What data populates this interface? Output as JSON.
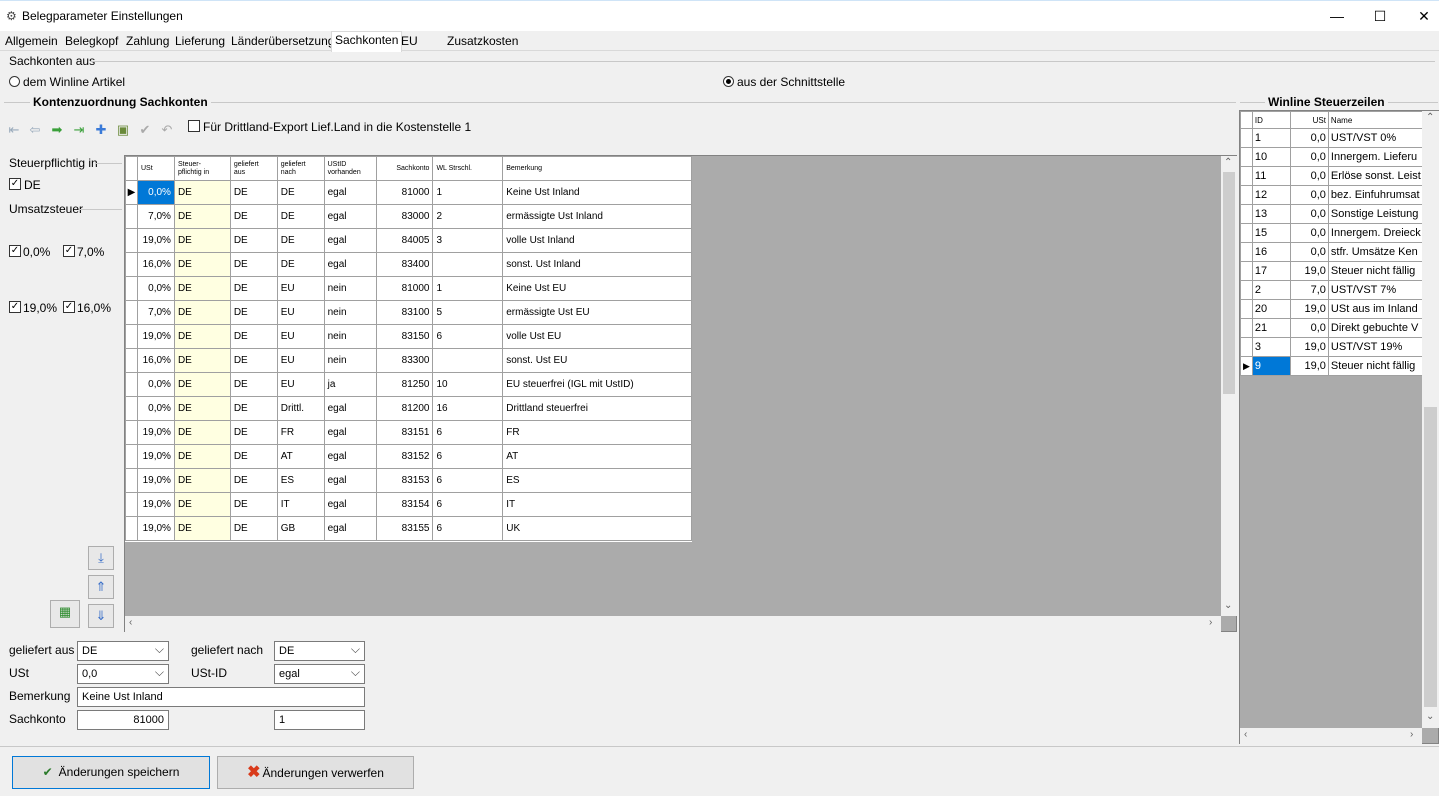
{
  "window": {
    "title": "Belegparameter Einstellungen",
    "minimize": "—",
    "maximize": "☐",
    "close": "✕"
  },
  "tabs": [
    "Allgemein",
    "Belegkopf",
    "Zahlung",
    "Lieferung",
    "Länderübersetzung",
    "Sachkonten",
    "EU",
    "Zusatzkosten"
  ],
  "active_tab": "Sachkonten",
  "source": {
    "label": "Sachkonten aus",
    "option1": "dem Winline Artikel",
    "option2": "aus der Schnittstelle",
    "selected": "aus der Schnittstelle"
  },
  "assignment": {
    "title": "Kontenzuordnung Sachkonten",
    "checkbox_label": "Für Drittland-Export Lief.Land in die Kostenstelle 1"
  },
  "filters": {
    "steuer_label": "Steuerpflichtig in",
    "de": "DE",
    "ust_label": "Umsatzsteuer",
    "r0": "0,0%",
    "r7": "7,0%",
    "r19": "19,0%",
    "r16": "16,0%"
  },
  "grid": {
    "headers": [
      "USt",
      "Steuer-\npflichtig in",
      "geliefert\naus",
      "geliefert\nnach",
      "UStID\nvorhanden",
      "Sachkonto",
      "WL Strschl.",
      "Bemerkung"
    ],
    "rows": [
      [
        "0,0%",
        "DE",
        "DE",
        "DE",
        "egal",
        "81000",
        "1",
        "Keine Ust Inland"
      ],
      [
        "7,0%",
        "DE",
        "DE",
        "DE",
        "egal",
        "83000",
        "2",
        "ermässigte Ust Inland"
      ],
      [
        "19,0%",
        "DE",
        "DE",
        "DE",
        "egal",
        "84005",
        "3",
        "volle Ust Inland"
      ],
      [
        "16,0%",
        "DE",
        "DE",
        "DE",
        "egal",
        "83400",
        "",
        "sonst. Ust Inland"
      ],
      [
        "0,0%",
        "DE",
        "DE",
        "EU",
        "nein",
        "81000",
        "1",
        "Keine Ust EU"
      ],
      [
        "7,0%",
        "DE",
        "DE",
        "EU",
        "nein",
        "83100",
        "5",
        "ermässigte Ust EU"
      ],
      [
        "19,0%",
        "DE",
        "DE",
        "EU",
        "nein",
        "83150",
        "6",
        "volle Ust EU"
      ],
      [
        "16,0%",
        "DE",
        "DE",
        "EU",
        "nein",
        "83300",
        "",
        "sonst. Ust EU"
      ],
      [
        "0,0%",
        "DE",
        "DE",
        "EU",
        "ja",
        "81250",
        "10",
        "EU steuerfrei (IGL mit UstID)"
      ],
      [
        "0,0%",
        "DE",
        "DE",
        "Drittl.",
        "egal",
        "81200",
        "16",
        "Drittland steuerfrei"
      ],
      [
        "19,0%",
        "DE",
        "DE",
        "FR",
        "egal",
        "83151",
        "6",
        "FR"
      ],
      [
        "19,0%",
        "DE",
        "DE",
        "AT",
        "egal",
        "83152",
        "6",
        "AT"
      ],
      [
        "19,0%",
        "DE",
        "DE",
        "ES",
        "egal",
        "83153",
        "6",
        "ES"
      ],
      [
        "19,0%",
        "DE",
        "DE",
        "IT",
        "egal",
        "83154",
        "6",
        "IT"
      ],
      [
        "19,0%",
        "DE",
        "DE",
        "GB",
        "egal",
        "83155",
        "6",
        "UK"
      ]
    ]
  },
  "form": {
    "geliefert_aus_label": "geliefert aus",
    "geliefert_aus": "DE",
    "geliefert_nach_label": "geliefert nach",
    "geliefert_nach": "DE",
    "ust_label": "USt",
    "ust": "0,0",
    "ustid_label": "USt-ID",
    "ustid": "egal",
    "bemerkung_label": "Bemerkung",
    "bemerkung": "Keine Ust Inland",
    "sachkonto_label": "Sachkonto",
    "sachkonto": "81000",
    "strschl": "1"
  },
  "steuerzeilen": {
    "title": "Winline Steuerzeilen",
    "headers": [
      "ID",
      "USt",
      "Name"
    ],
    "rows": [
      [
        "1",
        "0,0",
        "UST/VST 0%"
      ],
      [
        "10",
        "0,0",
        "Innergem. Lieferu"
      ],
      [
        "11",
        "0,0",
        "Erlöse sonst. Leist"
      ],
      [
        "12",
        "0,0",
        "bez. Einfuhrumsat"
      ],
      [
        "13",
        "0,0",
        "Sonstige Leistung"
      ],
      [
        "15",
        "0,0",
        "Innergem. Dreieck"
      ],
      [
        "16",
        "0,0",
        "stfr. Umsätze Ken"
      ],
      [
        "17",
        "19,0",
        "Steuer nicht fällig"
      ],
      [
        "2",
        "7,0",
        "UST/VST 7%"
      ],
      [
        "20",
        "19,0",
        "USt aus im Inland"
      ],
      [
        "21",
        "0,0",
        "Direkt gebuchte V"
      ],
      [
        "3",
        "19,0",
        "UST/VST 19%"
      ],
      [
        "9",
        "19,0",
        "Steuer nicht fällig"
      ]
    ]
  },
  "buttons": {
    "save": "Änderungen speichern",
    "discard": "Änderungen verwerfen"
  },
  "colors": {
    "selection": "#0078d7",
    "highlight": "#ffffe1",
    "save_icon": "#2a7a2a",
    "discard_icon": "#d93a1a"
  }
}
